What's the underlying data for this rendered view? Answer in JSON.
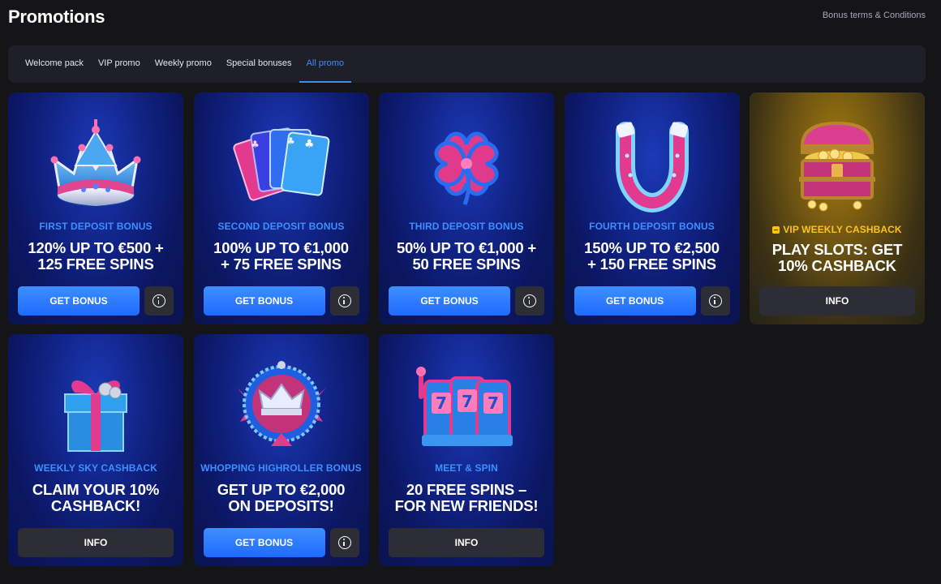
{
  "header": {
    "title": "Promotions",
    "terms_link": "Bonus terms & Conditions"
  },
  "tabs": [
    {
      "label": "Welcome pack",
      "active": false
    },
    {
      "label": "VIP promo",
      "active": false
    },
    {
      "label": "Weekly promo",
      "active": false
    },
    {
      "label": "Special bonuses",
      "active": false
    },
    {
      "label": "All promo",
      "active": true
    }
  ],
  "colors": {
    "accent": "#3e8bff",
    "label_blue": "#3e8fff",
    "vip_gold": "#ffc21a",
    "background": "#151518"
  },
  "promos": [
    {
      "icon": "crown-icon",
      "label": "FIRST DEPOSIT BONUS",
      "title": "120% UP TO €500 +\n125 FREE SPINS",
      "primary": "GET BONUS",
      "has_info_icon": true
    },
    {
      "icon": "cards-icon",
      "label": "SECOND DEPOSIT BONUS",
      "title": "100% UP TO €1,000\n+ 75 FREE SPINS",
      "primary": "GET BONUS",
      "has_info_icon": true
    },
    {
      "icon": "clover-icon",
      "label": "THIRD DEPOSIT BONUS",
      "title": "50% UP TO €1,000 +\n50 FREE SPINS",
      "primary": "GET BONUS",
      "has_info_icon": true
    },
    {
      "icon": "horseshoe-icon",
      "label": "FOURTH DEPOSIT BONUS",
      "title": "150% UP TO €2,500\n+ 150 FREE SPINS",
      "primary": "GET BONUS",
      "has_info_icon": true
    },
    {
      "icon": "treasure-chest-icon",
      "label": "VIP WEEKLY CASHBACK",
      "title": "PLAY SLOTS: GET\n10% CASHBACK",
      "secondary": "INFO",
      "vip": true
    },
    {
      "icon": "gift-box-icon",
      "label": "WEEKLY SKY CASHBACK",
      "title": "CLAIM YOUR 10%\nCASHBACK!",
      "secondary": "INFO"
    },
    {
      "icon": "highroller-crown-badge-icon",
      "label": "WHOPPING HIGHROLLER BONUS",
      "title": "GET UP TO €2,000\nON DEPOSITS!",
      "primary": "GET BONUS",
      "has_info_icon": true
    },
    {
      "icon": "slot-machine-icon",
      "label": "MEET & SPIN",
      "title": "20 FREE SPINS –\nFOR NEW FRIENDS!",
      "secondary": "INFO"
    }
  ]
}
